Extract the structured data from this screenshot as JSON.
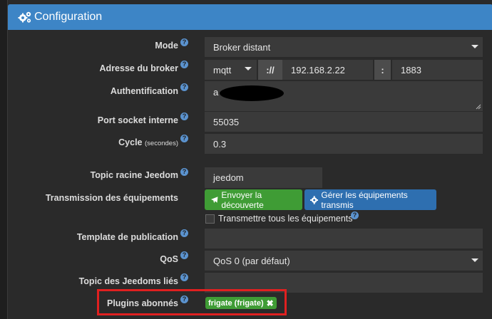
{
  "header": {
    "title": "Configuration",
    "icon": "cogs-icon"
  },
  "fields": {
    "mode": {
      "label": "Mode",
      "value": "Broker distant"
    },
    "broker": {
      "label": "Adresse du broker",
      "protocol": "mqtt",
      "separator1": "://",
      "host": "192.168.2.22",
      "separator2": ":",
      "port": "1883"
    },
    "auth": {
      "label": "Authentification",
      "value": "a"
    },
    "socket": {
      "label": "Port socket interne",
      "value": "55035"
    },
    "cycle": {
      "label": "Cycle",
      "unit": "(secondes)",
      "value": "0.3"
    },
    "topic_root": {
      "label": "Topic racine Jeedom",
      "value": "jeedom"
    },
    "transmission": {
      "label": "Transmission des équipements",
      "send_button": "Envoyer la découverte",
      "manage_button": "Gérer les équipements transmis",
      "checkbox_label": "Transmettre tous les équipements"
    },
    "template": {
      "label": "Template de publication",
      "value": ""
    },
    "qos": {
      "label": "QoS",
      "value": "QoS 0 (par défaut)"
    },
    "topic_linked": {
      "label": "Topic des Jeedoms liés",
      "value": ""
    },
    "plugins": {
      "label": "Plugins abonnés",
      "tag": "frigate (frigate)"
    }
  },
  "help_glyph": "?",
  "colors": {
    "header": "#3d85c6",
    "success": "#3f9c35",
    "primary": "#2e6fb0",
    "highlight": "#e02020"
  }
}
